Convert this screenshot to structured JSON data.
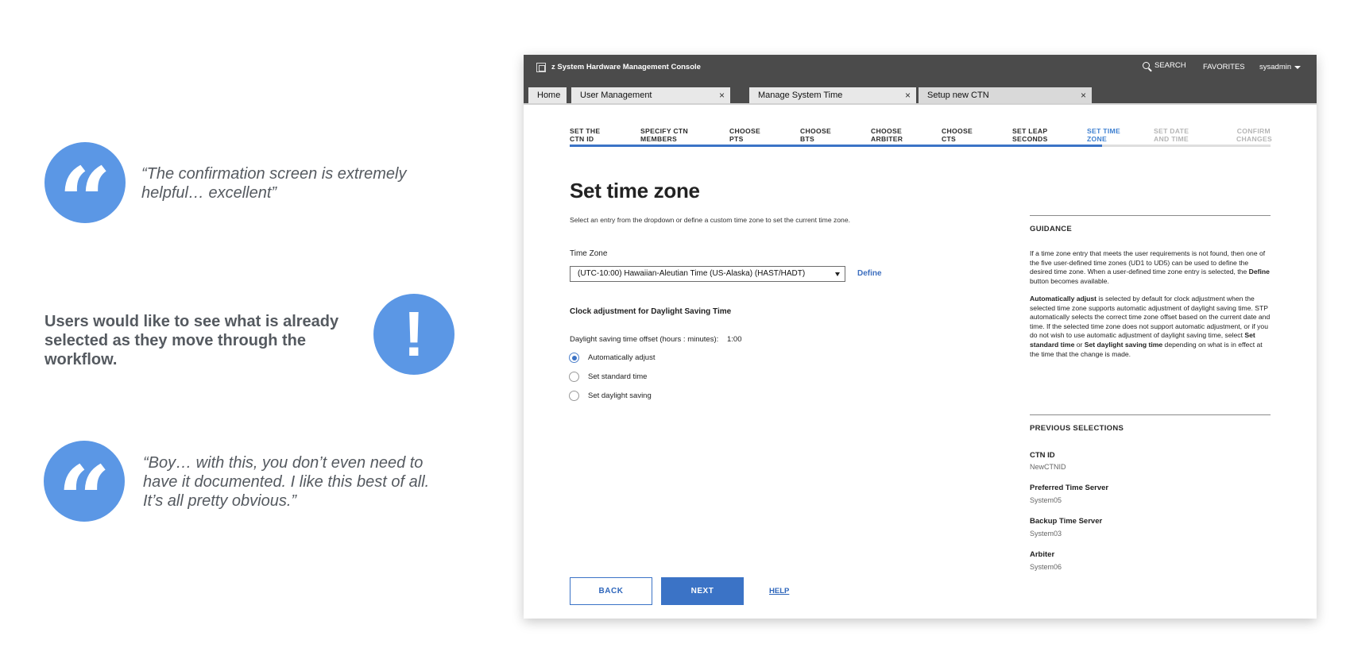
{
  "annotations": {
    "quote1": {
      "mark": "“",
      "text": "“The confirmation screen is extremely helpful… excellent”"
    },
    "remark": {
      "mark": "!",
      "text": "Users would like to see what is already selected as they move through the workflow."
    },
    "quote2": {
      "mark": "“",
      "text": "“Boy… with this, you don’t even need to have it documented. I like this best of all. It’s all pretty obvious.”"
    }
  },
  "colors": {
    "accent": "#3b73c6",
    "annotation_blue": "#5b97e5",
    "topbar": "#4b4b4b"
  },
  "header": {
    "app_title": "z System Hardware Management Console",
    "search_label": "SEARCH",
    "favorites_label": "FAVORITES",
    "user_label": "sysadmin"
  },
  "tabs": [
    {
      "label": "Home"
    },
    {
      "label": "User Management",
      "close": "×"
    },
    {
      "label": "Manage System Time",
      "close": "×"
    },
    {
      "label": "Setup new CTN",
      "close": "×"
    }
  ],
  "steps": [
    {
      "line1": "SET THE",
      "line2": "CTN ID"
    },
    {
      "line1": "SPECIFY CTN",
      "line2": "MEMBERS"
    },
    {
      "line1": "CHOOSE",
      "line2": "PTS"
    },
    {
      "line1": "CHOOSE",
      "line2": "BTS"
    },
    {
      "line1": "CHOOSE",
      "line2": "ARBITER"
    },
    {
      "line1": "CHOOSE",
      "line2": "CTS"
    },
    {
      "line1": "SET LEAP",
      "line2": "SECONDS"
    },
    {
      "line1": "SET TIME",
      "line2": "ZONE"
    },
    {
      "line1": "SET DATE",
      "line2": "AND TIME"
    },
    {
      "line1": "CONFIRM",
      "line2": "CHANGES"
    }
  ],
  "progress": {
    "current_step": 8,
    "total_steps": 10
  },
  "main": {
    "title": "Set time zone",
    "subtitle": "Select an entry from the dropdown or define a custom time zone to set the current time zone.",
    "timezone_label": "Time Zone",
    "timezone_value": "(UTC-10:00) Hawaiian-Aleutian Time (US-Alaska) (HAST/HADT)",
    "define_label": "Define",
    "dst_section_title": "Clock adjustment for Daylight Saving Time",
    "offset_label": "Daylight saving time offset (hours : minutes):",
    "offset_value": "1:00",
    "radios": [
      {
        "label": "Automatically adjust",
        "checked": true
      },
      {
        "label": "Set standard time",
        "checked": false
      },
      {
        "label": "Set daylight saving",
        "checked": false
      }
    ]
  },
  "guidance": {
    "title": "GUIDANCE",
    "p1_a": "If a time zone entry that meets the user requirements is not found, then one of the five user-defined time zones (UD1 to UD5) can be used to define the desired time zone. When a user-defined time zone entry is selected, the ",
    "p1_bold": "Define",
    "p1_b": " button becomes available.",
    "p2_bold1": "Automatically adjust",
    "p2_a": " is selected by default for clock adjustment when the selected time zone supports automatic adjustment of daylight saving time. STP automatically selects the correct time zone offset based on the current date and time. If the selected time zone does not support automatic adjustment, or if you do not wish to use automatic adjustment of daylight saving time, select ",
    "p2_bold2": "Set standard time",
    "p2_or": " or ",
    "p2_bold3": "Set daylight saving time",
    "p2_b": " depending on what is in effect at the time that the change is made."
  },
  "previous": {
    "title": "PREVIOUS SELECTIONS",
    "items": [
      {
        "label": "CTN ID",
        "value": "NewCTNID"
      },
      {
        "label": "Preferred Time Server",
        "value": "System05"
      },
      {
        "label": "Backup Time Server",
        "value": "System03"
      },
      {
        "label": "Arbiter",
        "value": "System06"
      }
    ]
  },
  "footer": {
    "back_label": "BACK",
    "next_label": "NEXT",
    "help_label": "HELP"
  }
}
